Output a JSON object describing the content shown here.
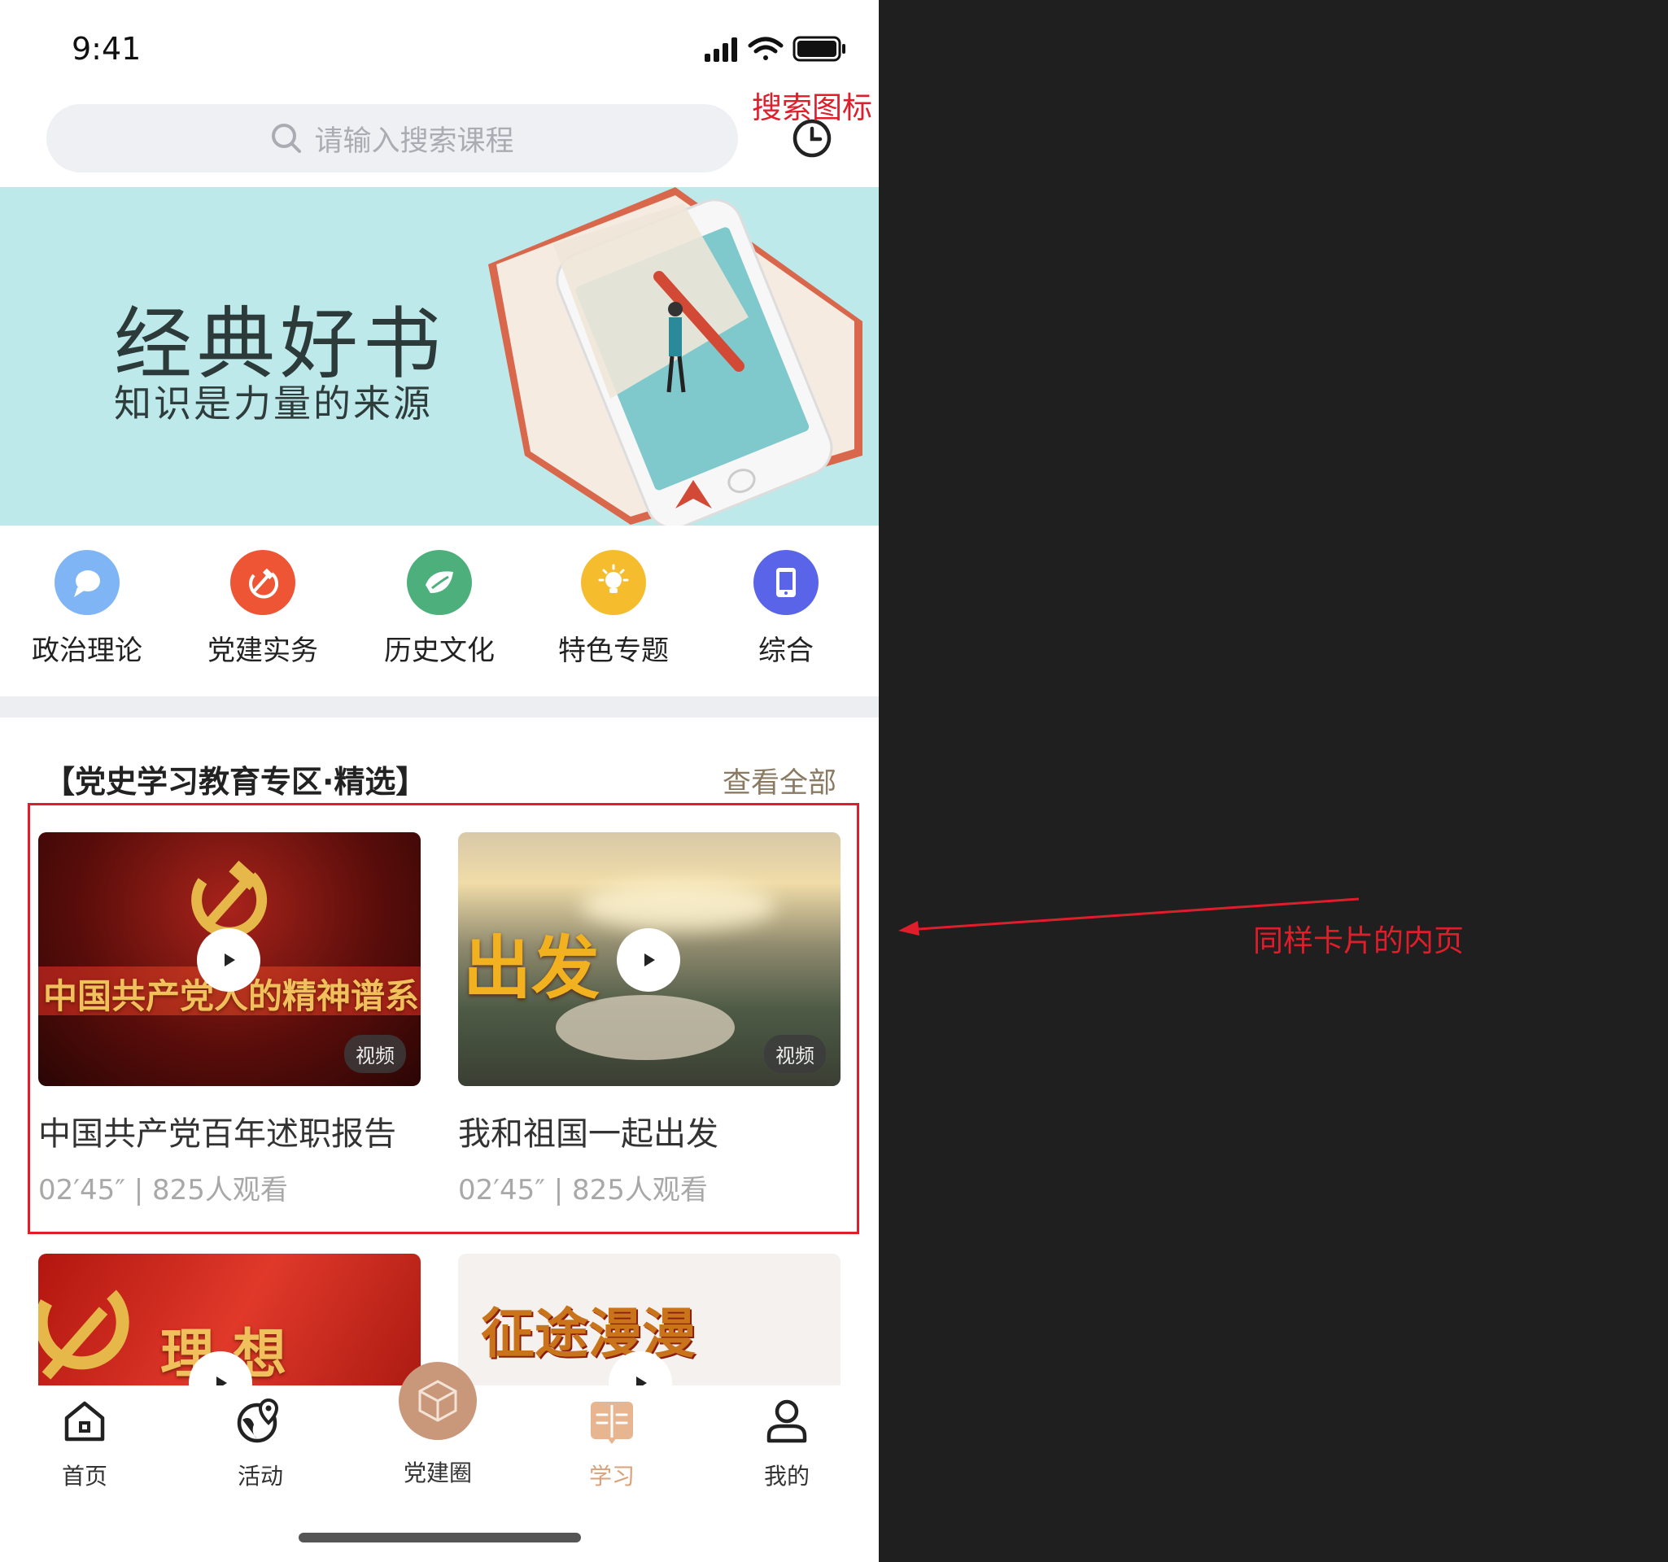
{
  "status_bar": {
    "time": "9:41"
  },
  "search": {
    "placeholder": "请输入搜索课程"
  },
  "banner": {
    "title": "经典好书",
    "subtitle": "知识是力量的来源"
  },
  "categories": [
    {
      "label": "政治理论",
      "icon": "chat-bubble-icon",
      "color": "#7fb4f5"
    },
    {
      "label": "党建实务",
      "icon": "hammer-sickle-icon",
      "color": "#ee5534"
    },
    {
      "label": "历史文化",
      "icon": "leaf-icon",
      "color": "#4db07c"
    },
    {
      "label": "特色专题",
      "icon": "lightbulb-icon",
      "color": "#f5bd2d"
    },
    {
      "label": "综合",
      "icon": "tablet-icon",
      "color": "#5a64e8"
    }
  ],
  "section": {
    "title": "【党史学习教育专区·精选】",
    "view_all": "查看全部"
  },
  "cards": [
    {
      "title": "中国共产党百年述职报告",
      "meta": "02′45″ | 825人观看",
      "badge": "视频",
      "thumb_text": "中国共产党人的精神谱系"
    },
    {
      "title": "我和祖国一起出发",
      "meta": "02′45″ | 825人观看",
      "badge": "视频",
      "thumb_text": "出发"
    },
    {
      "thumb_text": "理 想"
    },
    {
      "thumb_text": "征途漫漫"
    }
  ],
  "tabbar": {
    "items": [
      {
        "label": "首页",
        "icon": "home-icon"
      },
      {
        "label": "活动",
        "icon": "globe-location-icon"
      },
      {
        "label": "党建圈",
        "icon": "cube-icon"
      },
      {
        "label": "学习",
        "icon": "book-icon",
        "active": true
      },
      {
        "label": "我的",
        "icon": "user-icon"
      }
    ],
    "active_color": "#d9a27b"
  },
  "annotations": {
    "search_icon_note": "搜索图标",
    "card_note": "同样卡片的内页",
    "color": "#e01e2b"
  }
}
